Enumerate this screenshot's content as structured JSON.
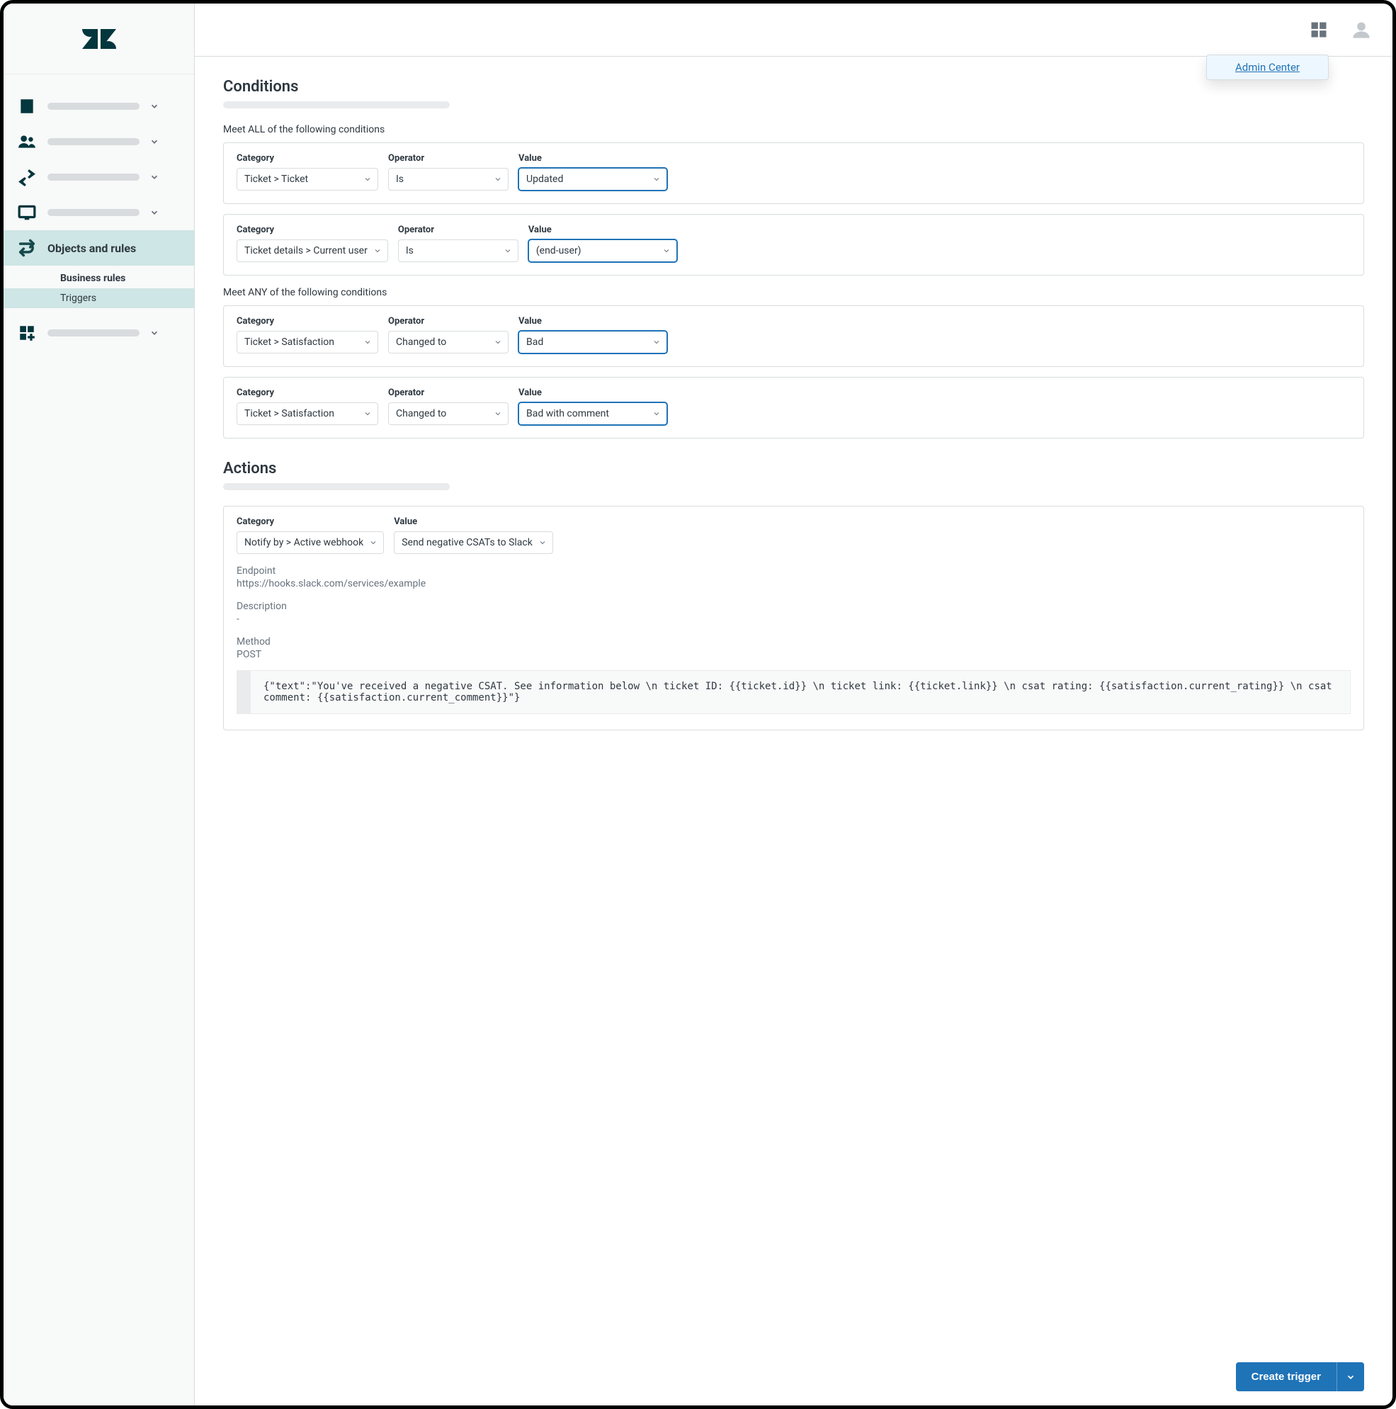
{
  "sidebar": {
    "active_label": "Objects and rules",
    "sub_heading": "Business rules",
    "sub_item": "Triggers"
  },
  "topbar": {
    "popup_link": "Admin Center"
  },
  "sections": {
    "conditions_title": "Conditions",
    "all_label": "Meet ALL of the following conditions",
    "any_label": "Meet ANY of the following conditions",
    "actions_title": "Actions"
  },
  "labels": {
    "category": "Category",
    "operator": "Operator",
    "value": "Value",
    "endpoint": "Endpoint",
    "description": "Description",
    "method": "Method"
  },
  "conditions_all": [
    {
      "category": "Ticket > Ticket",
      "operator": "Is",
      "value": "Updated"
    },
    {
      "category": "Ticket details > Current user",
      "operator": "Is",
      "value": "(end-user)"
    }
  ],
  "conditions_any": [
    {
      "category": "Ticket > Satisfaction",
      "operator": "Changed to",
      "value": "Bad"
    },
    {
      "category": "Ticket > Satisfaction",
      "operator": "Changed to",
      "value": "Bad with comment"
    }
  ],
  "action": {
    "category": "Notify by > Active webhook",
    "value": "Send negative CSATs to Slack",
    "endpoint": "https://hooks.slack.com/services/example",
    "description": "-",
    "method": "POST",
    "body": "{\"text\":\"You've received a negative CSAT. See information below \\n ticket ID: {{ticket.id}} \\n ticket link: {{ticket.link}} \\n csat rating: {{satisfaction.current_rating}} \\n csat comment: {{satisfaction.current_comment}}\"}"
  },
  "footer": {
    "create_label": "Create trigger"
  }
}
